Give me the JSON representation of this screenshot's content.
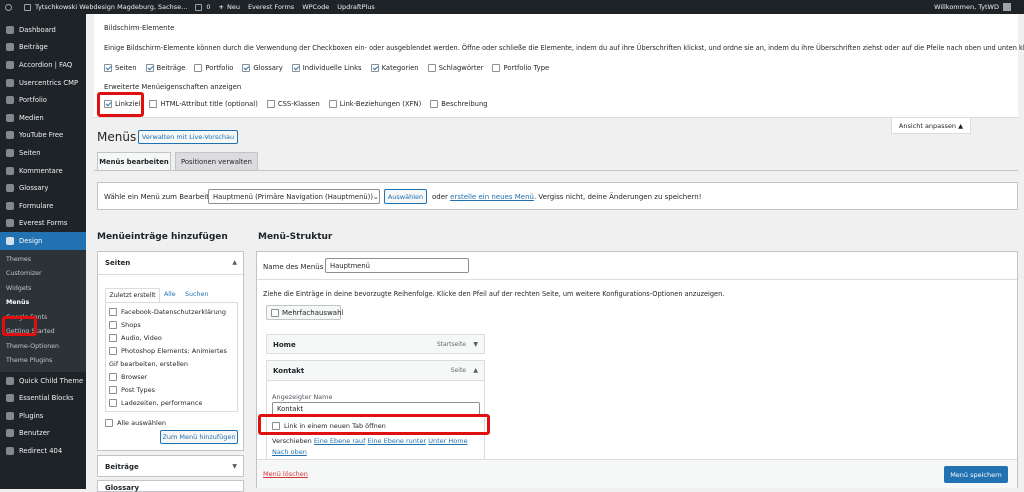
{
  "adminbar": {
    "wp_logo": "wordpress-icon",
    "site_name": "Tytschkowski Webdesign Magdeburg, Sachse...",
    "comments_count": "0",
    "new_label": "Neu",
    "links": [
      "Everest Forms",
      "WPCode",
      "UpdraftPlus"
    ],
    "welcome": "Willkommen, TytWD"
  },
  "sidebar": {
    "items_top": [
      "Dashboard",
      "Beiträge",
      "Accordion | FAQ",
      "Usercentrics CMP",
      "Portfolio",
      "Medien",
      "YouTube Free",
      "Seiten",
      "Kommentare",
      "Glossary",
      "Formulare",
      "Everest Forms"
    ],
    "active": "Design",
    "submenu": [
      "Themes",
      "Customizer",
      "Widgets",
      "Menüs",
      "Google Fonts",
      "Getting Started",
      "Theme-Optionen",
      "Theme Plugins"
    ],
    "items_bottom": [
      "Quick Child Theme",
      "Essential Blocks",
      "Plugins",
      "Benutzer",
      "Redirect 404"
    ]
  },
  "screen_options": {
    "heading": "Bildschirm-Elemente",
    "description": "Einige Bildschirm-Elemente können durch die Verwendung der Checkboxen ein- oder ausgeblendet werden. Öffne oder schließe die Elemente, indem du auf ihre Überschriften klickst, und ordne sie an, indem du ihre Überschriften ziehst oder auf die Pfeile nach oben und unten klickst.",
    "boxes": [
      {
        "label": "Seiten",
        "checked": true
      },
      {
        "label": "Beiträge",
        "checked": true
      },
      {
        "label": "Portfolio",
        "checked": false
      },
      {
        "label": "Glossary",
        "checked": true
      },
      {
        "label": "Individuelle Links",
        "checked": true
      },
      {
        "label": "Kategorien",
        "checked": true
      },
      {
        "label": "Schlagwörter",
        "checked": false
      },
      {
        "label": "Portfolio Type",
        "checked": false
      }
    ],
    "advanced_heading": "Erweiterte Menüeigenschaften anzeigen",
    "advanced": [
      {
        "label": "Linkziel",
        "checked": true
      },
      {
        "label": "HTML-Attribut title (optional)",
        "checked": false
      },
      {
        "label": "CSS-Klassen",
        "checked": false
      },
      {
        "label": "Link-Beziehungen (XFN)",
        "checked": false
      },
      {
        "label": "Beschreibung",
        "checked": false
      }
    ],
    "toggle_label": "Ansicht anpassen ▲"
  },
  "page": {
    "title": "Menüs",
    "live_preview": "Verwalten mit Live-Vorschau",
    "tabs": [
      "Menüs bearbeiten",
      "Positionen verwalten"
    ],
    "select_label": "Wähle ein Menü zum Bearbeiten:",
    "select_value": "Hauptmenü (Primäre Navigation (Hauptmenü))",
    "select_button": "Auswählen",
    "or_text": "oder",
    "create_link": "erstelle ein neues Menü",
    "save_reminder": ". Vergiss nicht, deine Änderungen zu speichern!"
  },
  "left": {
    "heading": "Menüeinträge hinzufügen",
    "box_title": "Seiten",
    "tabs": [
      "Zuletzt erstellt",
      "Alle",
      "Suchen"
    ],
    "pages": [
      {
        "label": "Facebook-Datenschutzerklärung",
        "checkbox": true
      },
      {
        "label": "Shops",
        "checkbox": true
      },
      {
        "label": "Audio, Video",
        "checkbox": true
      },
      {
        "label": "Photoshop Elements: Animiertes",
        "checkbox": true
      },
      {
        "label": "Gif bearbeiten, erstellen",
        "checkbox": false
      },
      {
        "label": "Browser",
        "checkbox": true
      },
      {
        "label": "Post Types",
        "checkbox": true
      },
      {
        "label": "Ladezeiten, performance",
        "checkbox": true
      }
    ],
    "select_all": "Alle auswählen",
    "add_button": "Zum Menü hinzufügen",
    "box2": "Beiträge",
    "box3": "Glossary"
  },
  "right": {
    "heading": "Menü-Struktur",
    "name_label": "Name des Menüs",
    "name_value": "Hauptmenü",
    "instructions": "Ziehe die Einträge in deine bevorzugte Reihenfolge. Klicke den Pfeil auf der rechten Seite, um weitere Konfigurations-Optionen anzuzeigen.",
    "bulk": "Mehrfachauswahl",
    "item1_title": "Home",
    "item1_type": "Startseite",
    "item2_title": "Kontakt",
    "item2_type": "Seite",
    "nav_label": "Angezeigter Name",
    "nav_value": "Kontakt",
    "new_tab": "Link in einem neuen Tab öffnen",
    "move_label": "Verschieben",
    "move_links": [
      "Eine Ebene rauf",
      "Eine Ebene runter",
      "Unter Home",
      "Nach oben"
    ],
    "delete": "Menü löschen",
    "save": "Menü speichern"
  },
  "colors": {
    "highlight": "#e01010",
    "primary": "#2271b1",
    "sidebar": "#1d2327"
  }
}
